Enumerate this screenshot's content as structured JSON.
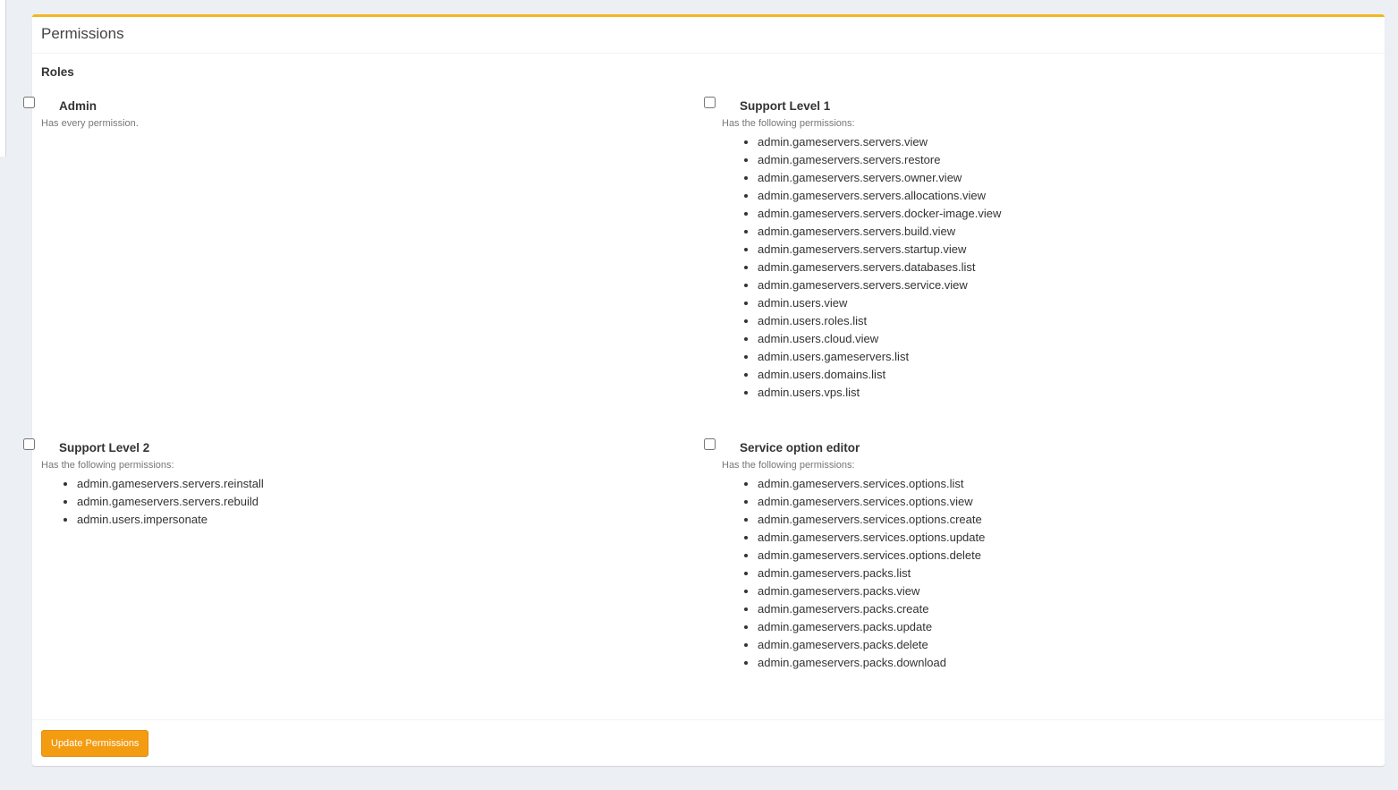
{
  "panel": {
    "title": "Permissions",
    "roles_label": "Roles",
    "update_button_label": "Update Permissions",
    "accent_color": "#f3b722",
    "button_color": "#f39c12"
  },
  "roles": [
    {
      "name": "Admin",
      "description": "Has every permission.",
      "checked": false,
      "permissions": []
    },
    {
      "name": "Support Level 1",
      "description": "Has the following permissions:",
      "checked": false,
      "permissions": [
        "admin.gameservers.servers.view",
        "admin.gameservers.servers.restore",
        "admin.gameservers.servers.owner.view",
        "admin.gameservers.servers.allocations.view",
        "admin.gameservers.servers.docker-image.view",
        "admin.gameservers.servers.build.view",
        "admin.gameservers.servers.startup.view",
        "admin.gameservers.servers.databases.list",
        "admin.gameservers.servers.service.view",
        "admin.users.view",
        "admin.users.roles.list",
        "admin.users.cloud.view",
        "admin.users.gameservers.list",
        "admin.users.domains.list",
        "admin.users.vps.list"
      ]
    },
    {
      "name": "Support Level 2",
      "description": "Has the following permissions:",
      "checked": false,
      "permissions": [
        "admin.gameservers.servers.reinstall",
        "admin.gameservers.servers.rebuild",
        "admin.users.impersonate"
      ]
    },
    {
      "name": "Service option editor",
      "description": "Has the following permissions:",
      "checked": false,
      "permissions": [
        "admin.gameservers.services.options.list",
        "admin.gameservers.services.options.view",
        "admin.gameservers.services.options.create",
        "admin.gameservers.services.options.update",
        "admin.gameservers.services.options.delete",
        "admin.gameservers.packs.list",
        "admin.gameservers.packs.view",
        "admin.gameservers.packs.create",
        "admin.gameservers.packs.update",
        "admin.gameservers.packs.delete",
        "admin.gameservers.packs.download"
      ]
    }
  ]
}
